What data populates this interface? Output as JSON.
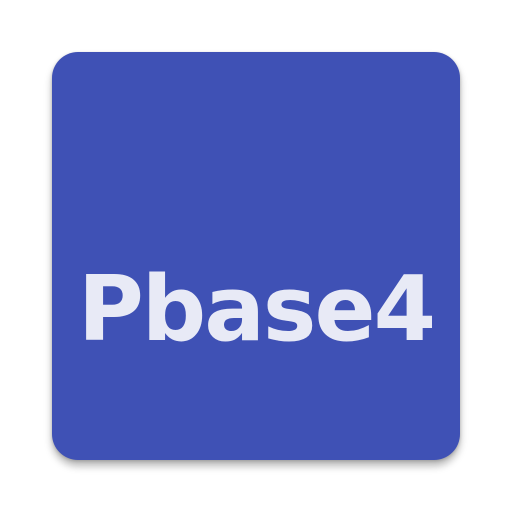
{
  "app_icon": {
    "label": "Pbase4",
    "background_color": "#3F51B5",
    "text_color": "#E8EAF6"
  }
}
